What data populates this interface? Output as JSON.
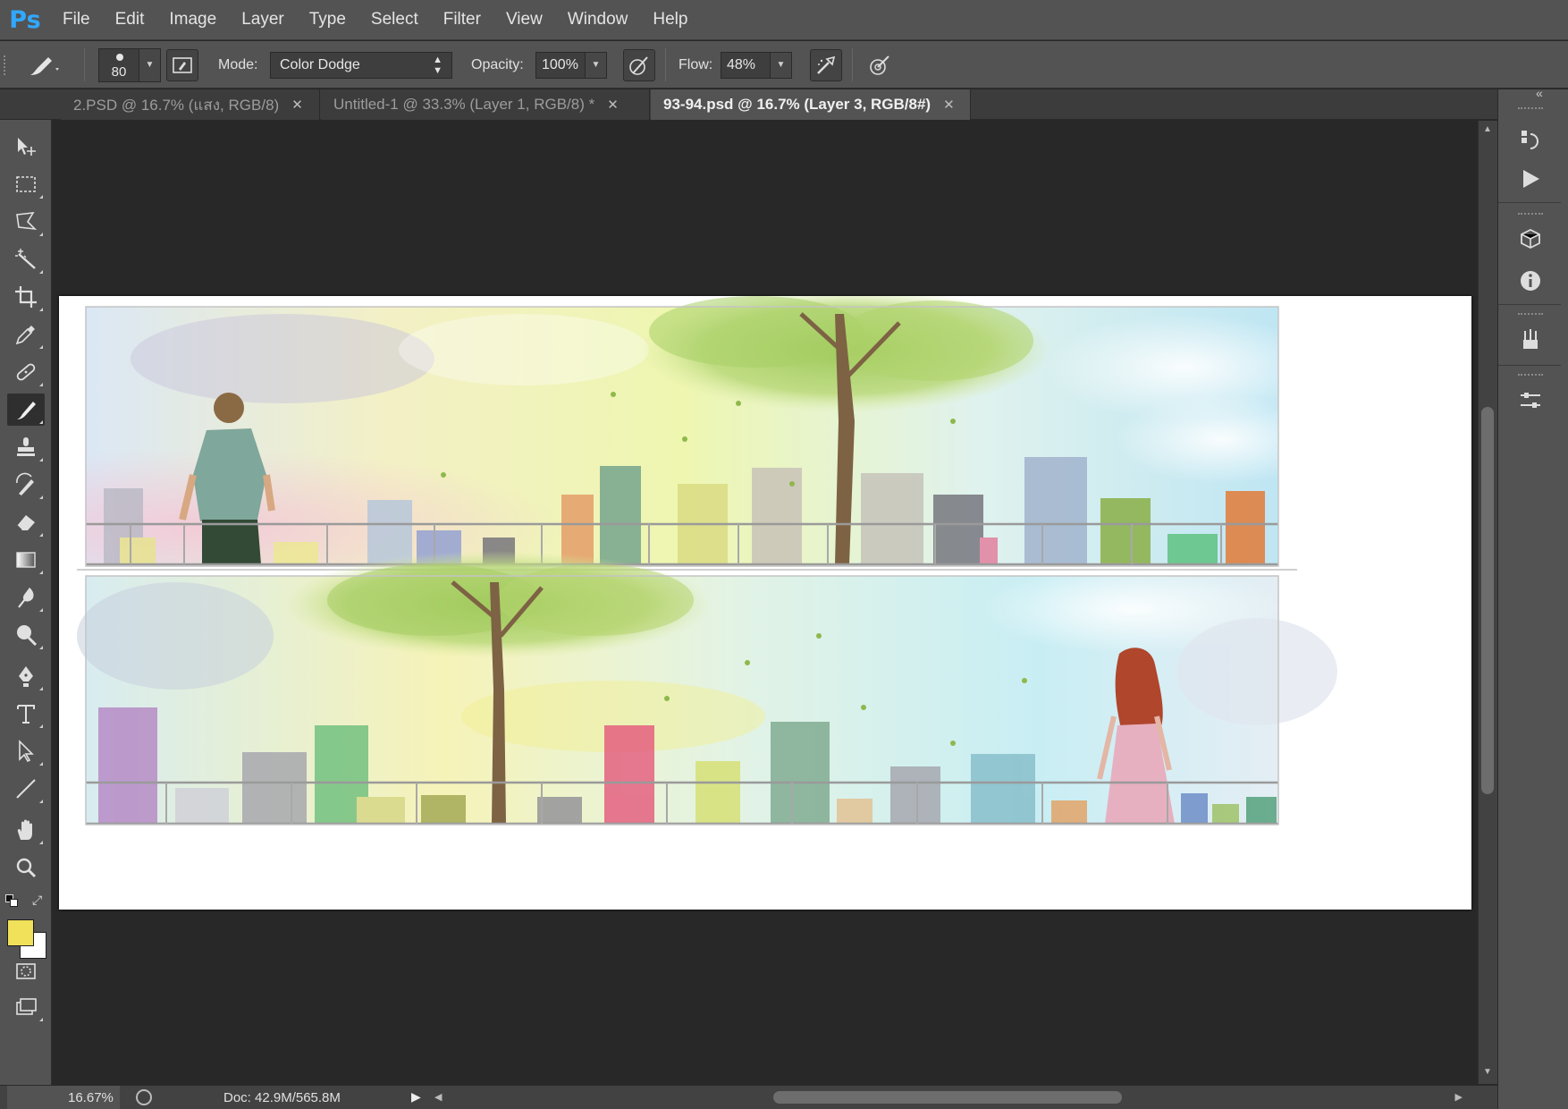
{
  "app": {
    "logo": "Ps",
    "menu": [
      "File",
      "Edit",
      "Image",
      "Layer",
      "Type",
      "Select",
      "Filter",
      "View",
      "Window",
      "Help"
    ]
  },
  "options_bar": {
    "brush_size": "80",
    "mode_label": "Mode:",
    "mode_value": "Color Dodge",
    "opacity_label": "Opacity:",
    "opacity_value": "100%",
    "flow_label": "Flow:",
    "flow_value": "48%"
  },
  "tabs": [
    {
      "label": "2.PSD @ 16.7% (แสง, RGB/8)",
      "active": false
    },
    {
      "label": "Untitled-1 @ 33.3% (Layer 1, RGB/8) *",
      "active": false
    },
    {
      "label": "93-94.psd @ 16.7% (Layer 3, RGB/8#)",
      "active": true
    }
  ],
  "tools": [
    {
      "name": "move-tool",
      "icon": "move-icon"
    },
    {
      "name": "marquee-tool",
      "icon": "rect-marquee-icon"
    },
    {
      "name": "lasso-tool",
      "icon": "polygonal-lasso-icon"
    },
    {
      "name": "magic-wand-tool",
      "icon": "magic-wand-icon"
    },
    {
      "name": "crop-tool",
      "icon": "crop-icon"
    },
    {
      "name": "eyedropper-tool",
      "icon": "eyedropper-icon"
    },
    {
      "name": "healing-brush-tool",
      "icon": "bandage-icon"
    },
    {
      "name": "brush-tool",
      "icon": "brush-icon",
      "active": true
    },
    {
      "name": "clone-stamp-tool",
      "icon": "stamp-icon"
    },
    {
      "name": "history-brush-tool",
      "icon": "history-brush-icon"
    },
    {
      "name": "eraser-tool",
      "icon": "eraser-icon"
    },
    {
      "name": "gradient-tool",
      "icon": "gradient-icon"
    },
    {
      "name": "blur-tool",
      "icon": "blur-drop-icon"
    },
    {
      "name": "dodge-tool",
      "icon": "dodge-icon"
    },
    {
      "name": "pen-tool",
      "icon": "pen-icon"
    },
    {
      "name": "type-tool",
      "icon": "type-icon"
    },
    {
      "name": "path-selection-tool",
      "icon": "path-select-arrow-icon"
    },
    {
      "name": "line-tool",
      "icon": "line-icon"
    },
    {
      "name": "hand-tool",
      "icon": "hand-icon"
    },
    {
      "name": "zoom-tool",
      "icon": "zoom-icon"
    }
  ],
  "colors": {
    "foreground": "#f0e05a",
    "background": "#ffffff"
  },
  "status": {
    "zoom": "16.67%",
    "doc": "Doc: 42.9M/565.8M"
  }
}
